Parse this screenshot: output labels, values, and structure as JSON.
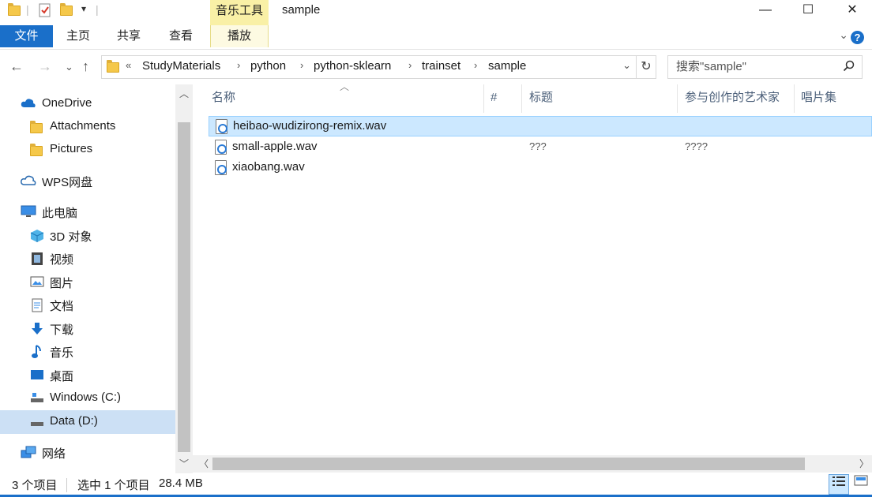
{
  "window": {
    "title": "sample",
    "context_tab": "音乐工具",
    "minimize": "—",
    "maximize": "☐",
    "close": "✕"
  },
  "ribbon": {
    "tabs": [
      "文件",
      "主页",
      "共享",
      "查看",
      "播放"
    ],
    "expand": "⌄",
    "help": "?"
  },
  "address": {
    "prefix": "«",
    "breadcrumb": [
      "StudyMaterials",
      "python",
      "python-sklearn",
      "trainset",
      "sample"
    ],
    "separator": "›",
    "dropdown": "⌄",
    "refresh": "↻"
  },
  "search": {
    "placeholder": "搜索\"sample\""
  },
  "nav": {
    "back": "←",
    "forward": "→",
    "recent": "⌄",
    "up": "↑"
  },
  "sidebar": {
    "items": [
      {
        "label": "OneDrive",
        "icon": "cloud-icon"
      },
      {
        "label": "Attachments",
        "icon": "folder-icon"
      },
      {
        "label": "Pictures",
        "icon": "folder-icon"
      },
      {
        "label": "WPS网盘",
        "icon": "cloud-outline-icon"
      },
      {
        "label": "此电脑",
        "icon": "computer-icon"
      },
      {
        "label": "3D 对象",
        "icon": "cube-icon"
      },
      {
        "label": "视频",
        "icon": "film-icon"
      },
      {
        "label": "图片",
        "icon": "picture-icon"
      },
      {
        "label": "文档",
        "icon": "document-icon"
      },
      {
        "label": "下载",
        "icon": "download-icon"
      },
      {
        "label": "音乐",
        "icon": "music-icon"
      },
      {
        "label": "桌面",
        "icon": "desktop-icon"
      },
      {
        "label": "Windows (C:)",
        "icon": "drive-icon"
      },
      {
        "label": "Data (D:)",
        "icon": "drive-icon"
      },
      {
        "label": "网络",
        "icon": "network-icon"
      }
    ]
  },
  "columns": [
    "名称",
    "#",
    "标题",
    "参与创作的艺术家",
    "唱片集"
  ],
  "files": [
    {
      "name": "heibao-wudizirong-remix.wav",
      "number": "",
      "title": "",
      "artist": ""
    },
    {
      "name": "small-apple.wav",
      "number": "",
      "title": "???",
      "artist": "????"
    },
    {
      "name": "xiaobang.wav",
      "number": "",
      "title": "",
      "artist": ""
    }
  ],
  "status": {
    "count": "3 个项目",
    "selection": "选中 1 个项目",
    "size": "28.4 MB"
  },
  "colors": {
    "accent": "#1a6fc9",
    "selected_row": "#cce8ff",
    "context_tab": "#f9f0a6"
  }
}
